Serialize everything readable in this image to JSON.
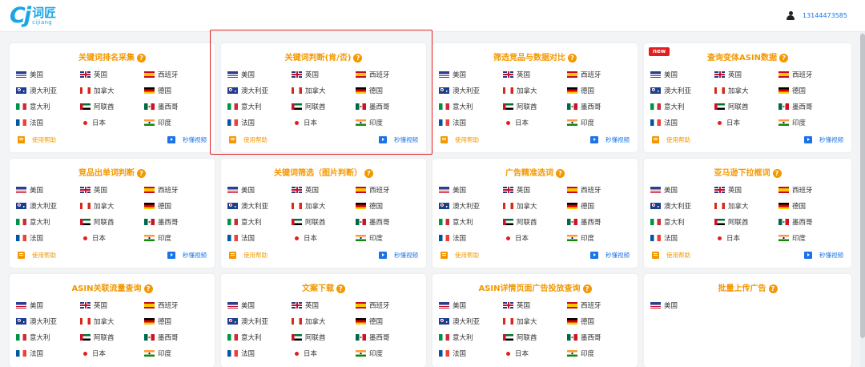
{
  "header": {
    "logo_mark": "Cj",
    "logo_cn": "词匠",
    "logo_en": "cijiang",
    "user_phone": "13144473585"
  },
  "colors": {
    "accent": "#f39800",
    "brand": "#1aa6e6",
    "link": "#1a73e8",
    "highlight": "#e02020"
  },
  "footer": {
    "help_label": "使用帮助",
    "video_label": "秒懂视频"
  },
  "cards": [
    {
      "title": "关键词排名采集",
      "countries": [
        "美国",
        "英国",
        "西班牙",
        "澳大利亚",
        "加拿大",
        "德国",
        "意大利",
        "阿联酋",
        "墨西哥",
        "法国",
        "日本",
        "印度"
      ],
      "footer": true
    },
    {
      "title": "关键词判断(肯/否)",
      "countries": [
        "美国",
        "英国",
        "西班牙",
        "澳大利亚",
        "加拿大",
        "德国",
        "意大利",
        "阿联酋",
        "墨西哥",
        "法国",
        "日本",
        "印度"
      ],
      "footer": true
    },
    {
      "title": "筛选竞品与数据对比",
      "countries": [
        "美国",
        "英国",
        "西班牙",
        "澳大利亚",
        "加拿大",
        "德国",
        "意大利",
        "阿联酋",
        "墨西哥",
        "法国",
        "日本",
        "印度"
      ],
      "footer": true
    },
    {
      "title": "查询变体ASIN数据",
      "badge": "new",
      "countries": [
        "美国",
        "英国",
        "西班牙",
        "澳大利亚",
        "加拿大",
        "德国",
        "意大利",
        "阿联酋",
        "墨西哥",
        "法国",
        "日本",
        "印度"
      ],
      "footer": true
    },
    {
      "title": "竞品出单词判断",
      "countries": [
        "美国",
        "英国",
        "西班牙",
        "澳大利亚",
        "加拿大",
        "德国",
        "意大利",
        "阿联酋",
        "墨西哥",
        "法国",
        "日本",
        "印度"
      ],
      "footer": true
    },
    {
      "title": "关键词筛选（图片判断）",
      "countries": [
        "美国",
        "英国",
        "西班牙",
        "澳大利亚",
        "加拿大",
        "德国",
        "意大利",
        "阿联酋",
        "墨西哥",
        "法国",
        "日本",
        "印度"
      ],
      "footer": true
    },
    {
      "title": "广告精准选词",
      "countries": [
        "美国",
        "英国",
        "西班牙",
        "澳大利亚",
        "加拿大",
        "德国",
        "意大利",
        "阿联酋",
        "墨西哥",
        "法国",
        "日本",
        "印度"
      ],
      "footer": true
    },
    {
      "title": "亚马逊下拉框词",
      "countries": [
        "美国",
        "英国",
        "西班牙",
        "澳大利亚",
        "加拿大",
        "德国",
        "意大利",
        "阿联酋",
        "墨西哥",
        "法国",
        "日本",
        "印度"
      ],
      "footer": true
    },
    {
      "title": "ASIN关联流量查询",
      "countries": [
        "美国",
        "英国",
        "西班牙",
        "澳大利亚",
        "加拿大",
        "德国",
        "意大利",
        "阿联酋",
        "墨西哥",
        "法国",
        "日本",
        "印度"
      ],
      "footer": false
    },
    {
      "title": "文案下载",
      "countries": [
        "美国",
        "英国",
        "西班牙",
        "澳大利亚",
        "加拿大",
        "德国",
        "意大利",
        "阿联酋",
        "墨西哥",
        "法国",
        "日本",
        "印度"
      ],
      "footer": false
    },
    {
      "title": "ASIN详情页面广告投放查询",
      "countries": [
        "美国",
        "英国",
        "西班牙",
        "澳大利亚",
        "加拿大",
        "德国",
        "意大利",
        "阿联酋",
        "墨西哥",
        "法国",
        "日本",
        "印度"
      ],
      "footer": false
    },
    {
      "title": "批量上传广告",
      "countries": [
        "美国"
      ],
      "footer": false
    }
  ]
}
